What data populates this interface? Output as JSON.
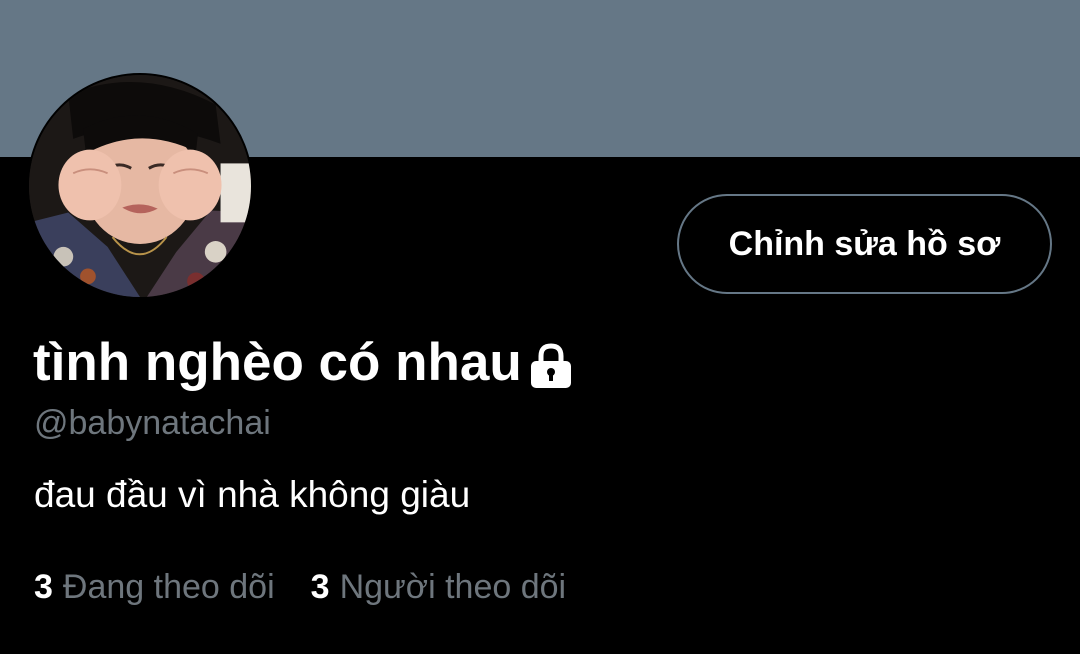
{
  "banner": {
    "color": "#657786"
  },
  "profile": {
    "display_name": "tình nghèo có nhau",
    "handle": "@babynatachai",
    "bio": "đau đầu vì nhà không giàu",
    "protected_icon": "lock-icon"
  },
  "actions": {
    "edit_profile_label": "Chỉnh sửa hồ sơ"
  },
  "stats": {
    "following_count": "3",
    "following_label": "Đang theo dõi",
    "followers_count": "3",
    "followers_label": "Người theo dõi"
  },
  "colors": {
    "background": "#000000",
    "primary_text": "#ffffff",
    "secondary_text": "#6e767d",
    "button_border": "#657786"
  }
}
